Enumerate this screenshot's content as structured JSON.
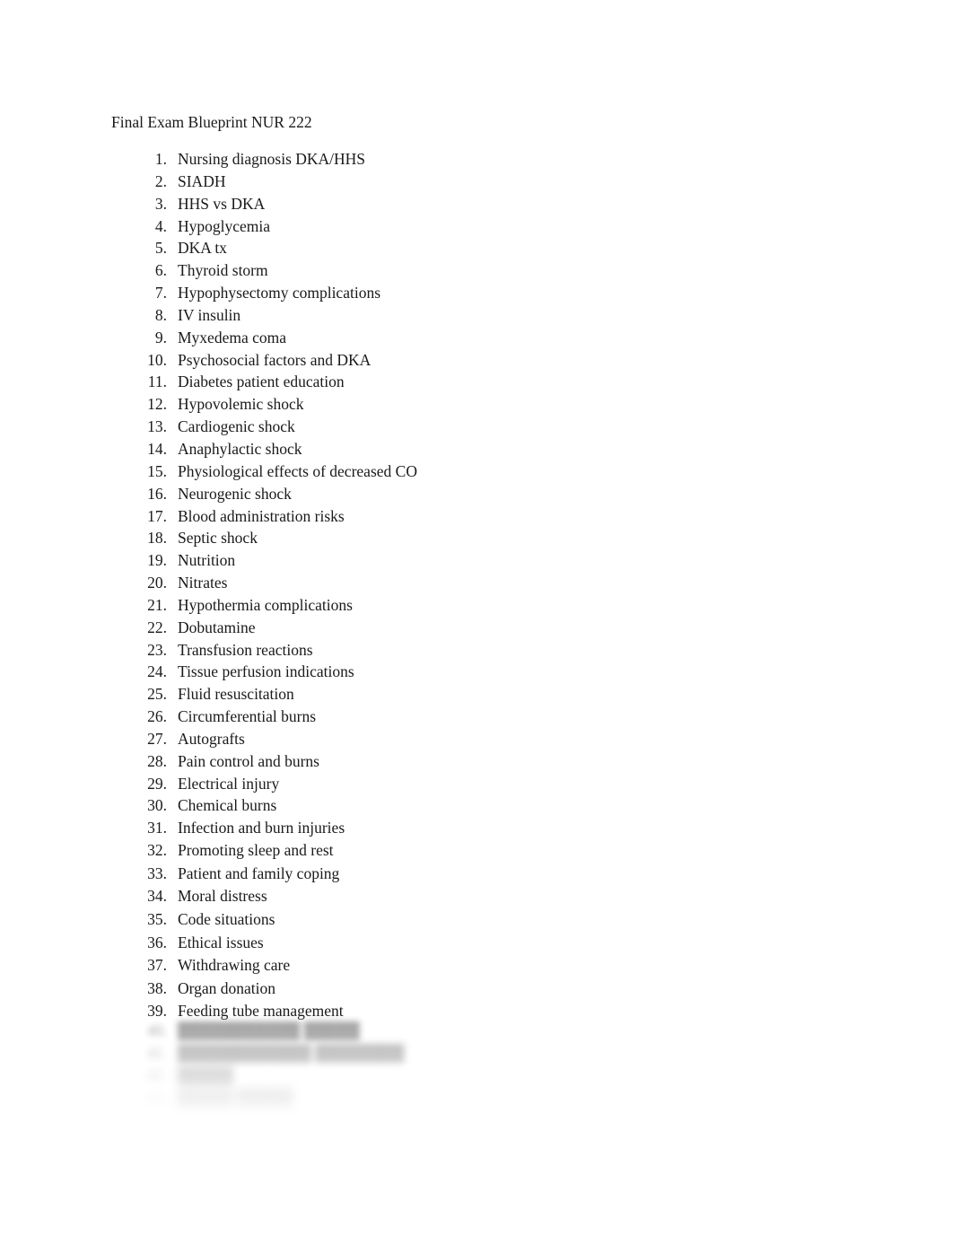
{
  "document": {
    "title": "Final Exam Blueprint NUR 222",
    "background_color": "#ffffff",
    "text_color": "#1a1a1a"
  },
  "list": {
    "items": [
      {
        "number": "1.",
        "text": "Nursing diagnosis DKA/HHS"
      },
      {
        "number": "2.",
        "text": "SIADH"
      },
      {
        "number": "3.",
        "text": "HHS vs DKA"
      },
      {
        "number": "4.",
        "text": "Hypoglycemia"
      },
      {
        "number": "5.",
        "text": "DKA tx"
      },
      {
        "number": "6.",
        "text": "Thyroid storm"
      },
      {
        "number": "7.",
        "text": "Hypophysectomy complications"
      },
      {
        "number": "8.",
        "text": "IV insulin"
      },
      {
        "number": "9.",
        "text": "Myxedema coma"
      },
      {
        "number": "10.",
        "text": "Psychosocial factors and DKA"
      },
      {
        "number": "11.",
        "text": "Diabetes patient education"
      },
      {
        "number": "12.",
        "text": "Hypovolemic shock"
      },
      {
        "number": "13.",
        "text": "Cardiogenic shock"
      },
      {
        "number": "14.",
        "text": "Anaphylactic shock"
      },
      {
        "number": "15.",
        "text": "Physiological effects of decreased CO"
      },
      {
        "number": "16.",
        "text": "Neurogenic shock"
      },
      {
        "number": "17.",
        "text": "Blood administration risks"
      },
      {
        "number": "18.",
        "text": "Septic shock"
      },
      {
        "number": "19.",
        "text": "Nutrition"
      },
      {
        "number": "20.",
        "text": "Nitrates"
      },
      {
        "number": "21.",
        "text": "Hypothermia complications"
      },
      {
        "number": "22.",
        "text": "Dobutamine"
      },
      {
        "number": "23.",
        "text": "Transfusion reactions"
      },
      {
        "number": "24.",
        "text": "Tissue perfusion indications"
      },
      {
        "number": "25.",
        "text": "Fluid resuscitation"
      },
      {
        "number": "26.",
        "text": "Circumferential burns"
      },
      {
        "number": "27.",
        "text": "Autografts"
      },
      {
        "number": "28.",
        "text": "Pain control and burns"
      },
      {
        "number": "29.",
        "text": "Electrical injury"
      },
      {
        "number": "30.",
        "text": "Chemical burns"
      },
      {
        "number": "31.",
        "text": "Infection and burn injuries"
      },
      {
        "number": "32.",
        "text": "Promoting sleep and rest"
      },
      {
        "number": "33.",
        "text": "Patient and family coping"
      },
      {
        "number": "34.",
        "text": "Moral distress"
      },
      {
        "number": "35.",
        "text": "Code situations"
      },
      {
        "number": "36.",
        "text": "Ethical issues"
      },
      {
        "number": "37.",
        "text": "Withdrawing care"
      },
      {
        "number": "38.",
        "text": "Organ donation"
      },
      {
        "number": "39.",
        "text": "Feeding tube management"
      }
    ]
  },
  "obscured_preview": {
    "note": "Remaining list rows are blurred out by a preview fade and are not legible.",
    "rows": [
      {
        "number": "40.",
        "text": "███████████ █████"
      },
      {
        "number": "41.",
        "text": "████████████ ████████"
      },
      {
        "number": "42.",
        "text": "█████"
      },
      {
        "number": "43.",
        "text": "█████ █████"
      }
    ]
  }
}
